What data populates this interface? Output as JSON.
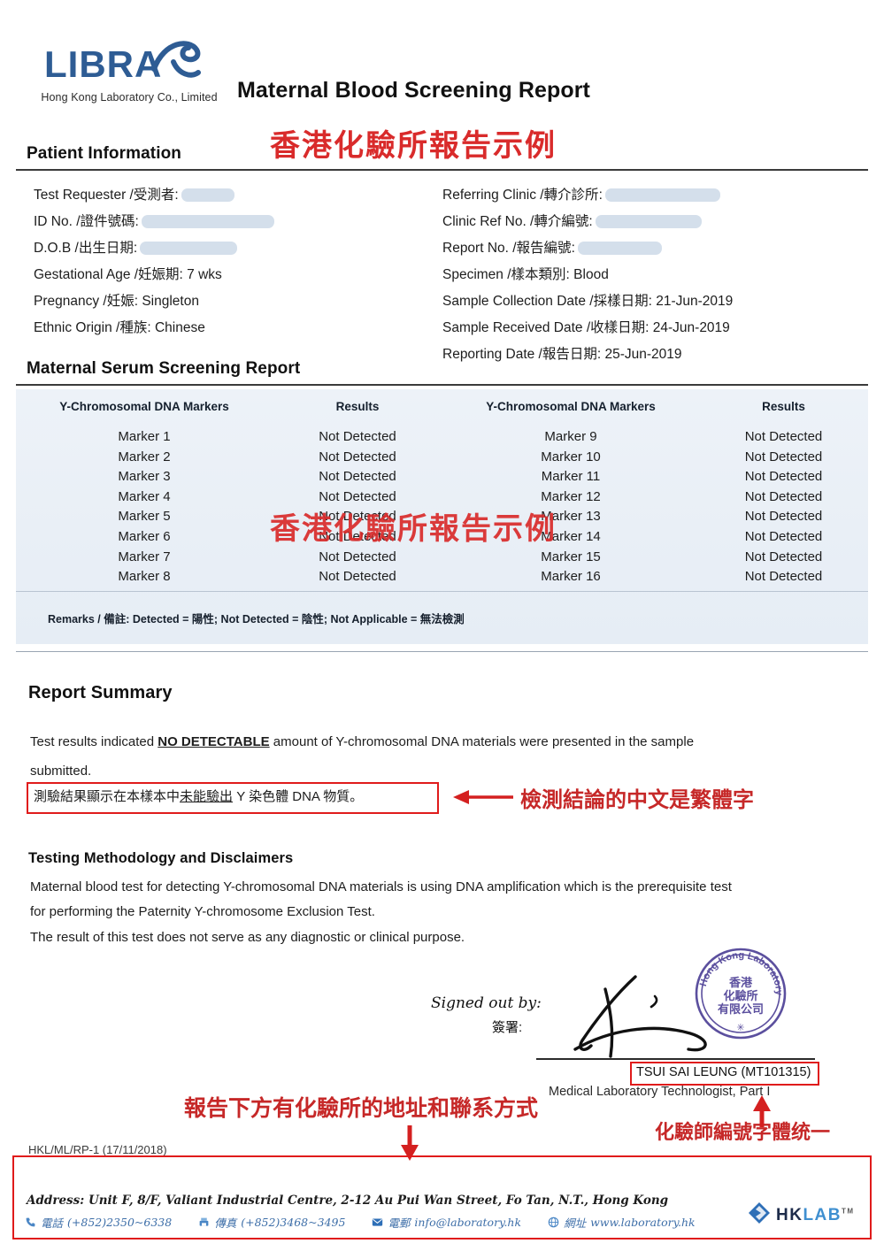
{
  "header": {
    "logo_text": "LIBRA",
    "logo_subtitle": "Hong Kong Laboratory Co., Limited",
    "document_title": "Maternal Blood Screening Report",
    "watermark": "香港化驗所報告示例"
  },
  "patient_information": {
    "section_title": "Patient Information",
    "left_fields": [
      {
        "label": "Test Requester /受測者:",
        "value": "",
        "redacted": true,
        "redact_width": 60
      },
      {
        "label": "ID No. /證件號碼:",
        "value": "",
        "redacted": true,
        "redact_width": 150
      },
      {
        "label": "D.O.B /出生日期:",
        "value": "",
        "redacted": true,
        "redact_width": 110
      },
      {
        "label": "Gestational Age /妊娠期:",
        "value": "7 wks",
        "redacted": false,
        "redact_width": 0
      },
      {
        "label": "Pregnancy /妊娠:",
        "value": "Singleton",
        "redacted": false,
        "redact_width": 0
      },
      {
        "label": "Ethnic Origin /種族:",
        "value": "Chinese",
        "redacted": false,
        "redact_width": 0
      }
    ],
    "right_fields": [
      {
        "label": "Referring Clinic /轉介診所:",
        "value": "",
        "redacted": true,
        "redact_width": 130
      },
      {
        "label": "Clinic Ref No. /轉介編號:",
        "value": "",
        "redacted": true,
        "redact_width": 120
      },
      {
        "label": "Report No. /報告編號:",
        "value": "",
        "redacted": true,
        "redact_width": 95
      },
      {
        "label": "Specimen /樣本類別:",
        "value": "Blood",
        "redacted": false,
        "redact_width": 0
      },
      {
        "label": "Sample Collection Date /採樣日期:",
        "value": "21-Jun-2019",
        "redacted": false,
        "redact_width": 0
      },
      {
        "label": "Sample Received Date /收樣日期:",
        "value": "24-Jun-2019",
        "redacted": false,
        "redact_width": 0
      },
      {
        "label": "Reporting Date /報告日期:",
        "value": "25-Jun-2019",
        "redacted": false,
        "redact_width": 0
      }
    ]
  },
  "serum_report": {
    "section_title": "Maternal Serum Screening Report",
    "columns": [
      "Y-Chromosomal DNA Markers",
      "Results",
      "Y-Chromosomal DNA Markers",
      "Results"
    ],
    "rows": [
      {
        "marker_left": "Marker 1",
        "result_left": "Not Detected",
        "marker_right": "Marker 9",
        "result_right": "Not Detected"
      },
      {
        "marker_left": "Marker 2",
        "result_left": "Not Detected",
        "marker_right": "Marker 10",
        "result_right": "Not Detected"
      },
      {
        "marker_left": "Marker 3",
        "result_left": "Not Detected",
        "marker_right": "Marker 11",
        "result_right": "Not Detected"
      },
      {
        "marker_left": "Marker 4",
        "result_left": "Not Detected",
        "marker_right": "Marker 12",
        "result_right": "Not Detected"
      },
      {
        "marker_left": "Marker 5",
        "result_left": "Not Detected",
        "marker_right": "Marker 13",
        "result_right": "Not Detected"
      },
      {
        "marker_left": "Marker 6",
        "result_left": "Not Detected",
        "marker_right": "Marker 14",
        "result_right": "Not Detected"
      },
      {
        "marker_left": "Marker 7",
        "result_left": "Not Detected",
        "marker_right": "Marker 15",
        "result_right": "Not Detected"
      },
      {
        "marker_left": "Marker 8",
        "result_left": "Not Detected",
        "marker_right": "Marker 16",
        "result_right": "Not Detected"
      }
    ],
    "remarks": "Remarks /  備註: Detected =  陽性; Not Detected =  陰性; Not Applicable =  無法檢測",
    "watermark": "香港化驗所報告示例"
  },
  "report_summary": {
    "section_title": "Report Summary",
    "line1_prefix": "Test results indicated ",
    "line1_emphasis": "NO DETECTABLE",
    "line1_suffix": " amount of Y-chromosomal DNA materials were presented in the sample",
    "line2": "submitted.",
    "chinese_prefix": "測驗結果顯示在本樣本中",
    "chinese_underline": "未能驗出",
    "chinese_suffix": " Y 染色體 DNA 物質。"
  },
  "methodology": {
    "section_title": "Testing Methodology and Disclaimers",
    "line1": "Maternal blood test for detecting Y-chromosomal DNA materials is using DNA amplification which is the prerequisite test",
    "line2": "for performing the Paternity Y-chromosome Exclusion Test.",
    "line3": "The result of this test does not serve as any diagnostic or clinical purpose."
  },
  "signature": {
    "signed_out_by": "Signed out by:",
    "signed_out_by_cn": "簽署:",
    "technologist_name": "TSUI SAI LEUNG (MT101315)",
    "technologist_title": "Medical Laboratory Technologist, Part I",
    "stamp_outer_text": "Hong Kong Laboratory Co., Limited",
    "stamp_inner_lines": [
      "香港",
      "化驗所",
      "有限公司"
    ]
  },
  "annotations": {
    "chinese_conclusion_note": "檢測結論的中文是繁體字",
    "address_note": "報告下方有化驗所的地址和聯系方式",
    "technologist_note": "化驗師編號字體统一"
  },
  "footer": {
    "form_code": "HKL/ML/RP-1 (17/11/2018)",
    "address": "Address: Unit F, 8/F, Valiant Industrial Centre, 2-12 Au Pui Wan Street, Fo Tan, N.T., Hong Kong",
    "contacts": [
      {
        "icon": "phone-icon",
        "label": "電話",
        "value": "(+852)2350~6338"
      },
      {
        "icon": "fax-icon",
        "label": "傳真",
        "value": "(+852)3468~3495"
      },
      {
        "icon": "email-icon",
        "label": "電郵",
        "value": "info@laboratory.hk"
      },
      {
        "icon": "website-icon",
        "label": "網址",
        "value": "www.laboratory.hk"
      }
    ],
    "brand_hk": "HK",
    "brand_lab": "LAB",
    "trademark": "TM"
  },
  "colors": {
    "annotation_red": "#d92b2b",
    "brand_blue": "#3f6fa8",
    "table_bg": "#eaf0f7",
    "stamp_purple": "#5b4f9e"
  }
}
